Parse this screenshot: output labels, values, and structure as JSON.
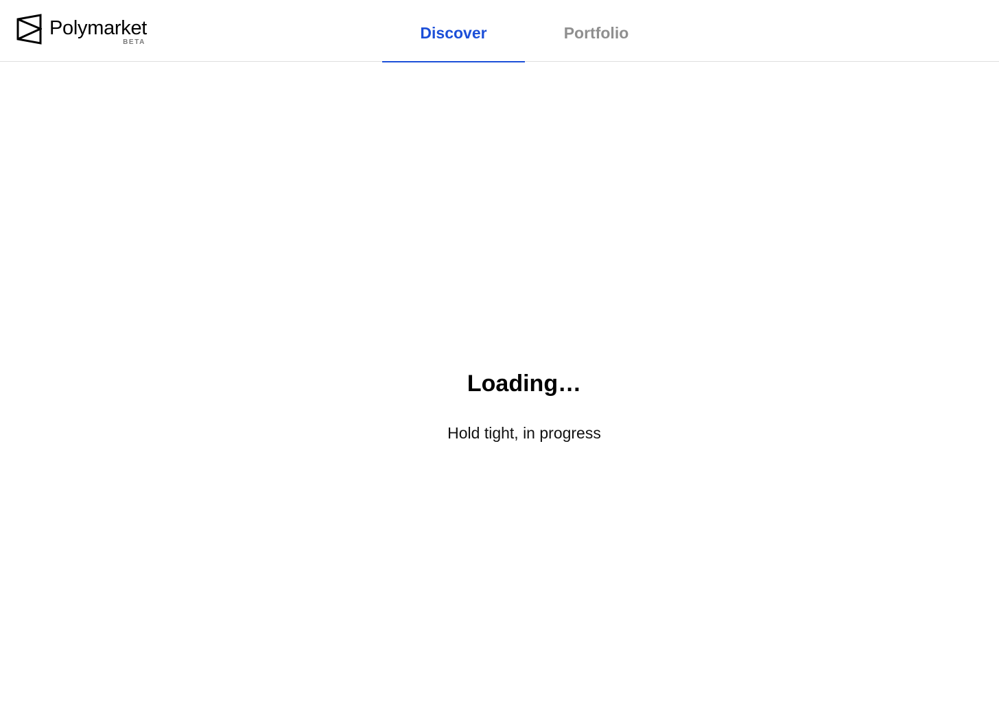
{
  "header": {
    "logo": {
      "name": "Polymarket",
      "badge": "BETA",
      "icon": "polymarket-logo-icon"
    },
    "tabs": [
      {
        "label": "Discover",
        "active": true
      },
      {
        "label": "Portfolio",
        "active": false
      }
    ],
    "accent_color": "#1c4fd8",
    "inactive_color": "#8f8f8f"
  },
  "main": {
    "title": "Loading…",
    "subtitle": "Hold tight, in progress"
  }
}
